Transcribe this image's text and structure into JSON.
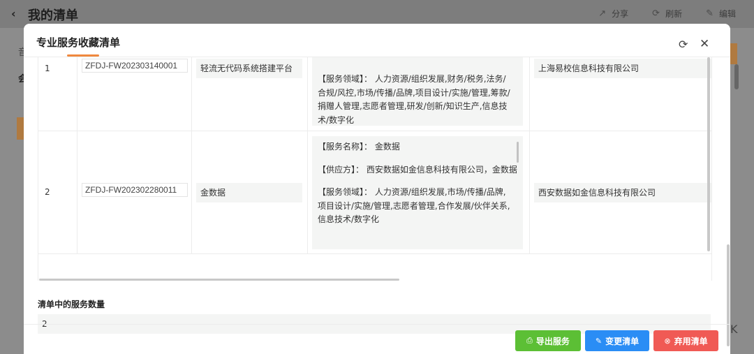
{
  "background": {
    "back_glyph": "‹",
    "title": "我的清单",
    "actions": [
      {
        "icon": "share-icon",
        "glyph": "↗",
        "label": "分享"
      },
      {
        "icon": "refresh-icon",
        "glyph": "⟳",
        "label": "刷新"
      },
      {
        "icon": "edit-icon",
        "glyph": "✎",
        "label": "编辑"
      }
    ],
    "left_char_1": "音",
    "left_char_2": "会",
    "corner_glyph": "K"
  },
  "modal": {
    "title": "专业服务收藏清单",
    "refresh_glyph": "⟳",
    "close_glyph": "✕",
    "rows": [
      {
        "no": "1",
        "code": "ZFDJ-FW202303140001",
        "name": "轻流无代码系统搭建平台",
        "detail_lines": [
          "【服务领域】： 人力资源/组织发展,财务/税务,法务/合规/风控,市场/传播/品牌,项目设计/实施/管理,筹款/捐赠人管理,志愿者管理,研发/创新/知识生产,信息技术/数字化"
        ],
        "supplier": "上海易校信息科技有限公司"
      },
      {
        "no": "2",
        "code": "ZFDJ-FW202302280011",
        "name": "金数据",
        "detail_lines": [
          "【服务名称】： 金数据",
          "【供应方】： 西安数据如金信息科技有限公司，金数据",
          "【服务领域】： 人力资源/组织发展,市场/传播/品牌,项目设计/实施/管理,志愿者管理,合作发展/伙伴关系,信息技术/数字化"
        ],
        "supplier": "西安数据如金信息科技有限公司"
      }
    ],
    "count_label": "清单中的服务数量",
    "count_value": "2",
    "buttons": {
      "export": {
        "icon": "printer-icon",
        "glyph": "⎙",
        "label": "导出服务"
      },
      "change": {
        "icon": "pencil-icon",
        "glyph": "✎",
        "label": "变更清单"
      },
      "discard": {
        "icon": "cancel-circle-icon",
        "glyph": "⊗",
        "label": "弃用清单"
      }
    }
  },
  "colors": {
    "accent": "#f0883e",
    "export_button": "#5cbf35",
    "change_button": "#2a8df5",
    "discard_button": "#f05a55"
  }
}
